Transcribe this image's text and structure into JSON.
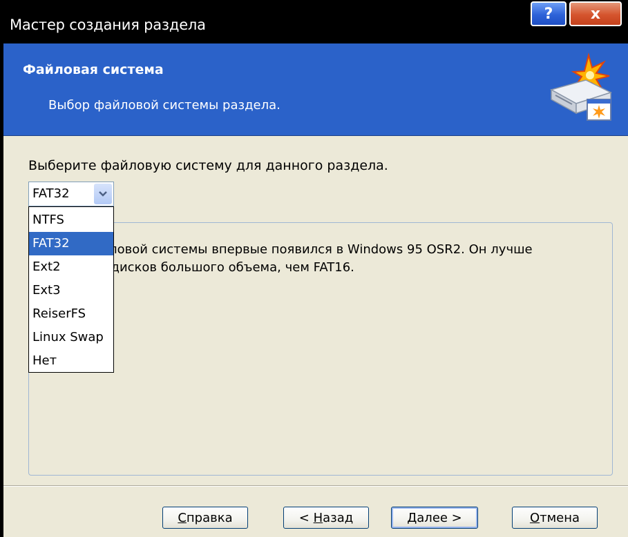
{
  "window": {
    "title": "Мастер создания раздела",
    "help_button": "?",
    "close_button": "x"
  },
  "header": {
    "title": "Файловая система",
    "subtitle": "Выбор файловой системы раздела.",
    "icon": "disk-wizard-icon"
  },
  "main": {
    "prompt": "Выберите файловую систему для данного раздела.",
    "filesystem_select": {
      "value": "FAT32",
      "options": [
        "NTFS",
        "FAT32",
        "Ext2",
        "Ext3",
        "ReiserFS",
        "Linux Swap",
        "Нет"
      ],
      "highlighted": "FAT32"
    },
    "description_line1": "файловой системы впервые появился в Windows 95 OSR2. Он лучше",
    "description_line2": "для дисков большого объема, чем FAT16."
  },
  "buttons": {
    "help": {
      "prefix": "",
      "accel": "С",
      "rest": "правка"
    },
    "back": {
      "prefix": "< ",
      "accel": "Н",
      "rest": "азад"
    },
    "next": {
      "prefix": "",
      "accel": "Д",
      "rest": "алее >"
    },
    "cancel": {
      "prefix": "",
      "accel": "О",
      "rest": "тмена"
    }
  },
  "colors": {
    "header_bg": "#2b62c9",
    "selection": "#316ac5",
    "titlebar": "#000000"
  }
}
